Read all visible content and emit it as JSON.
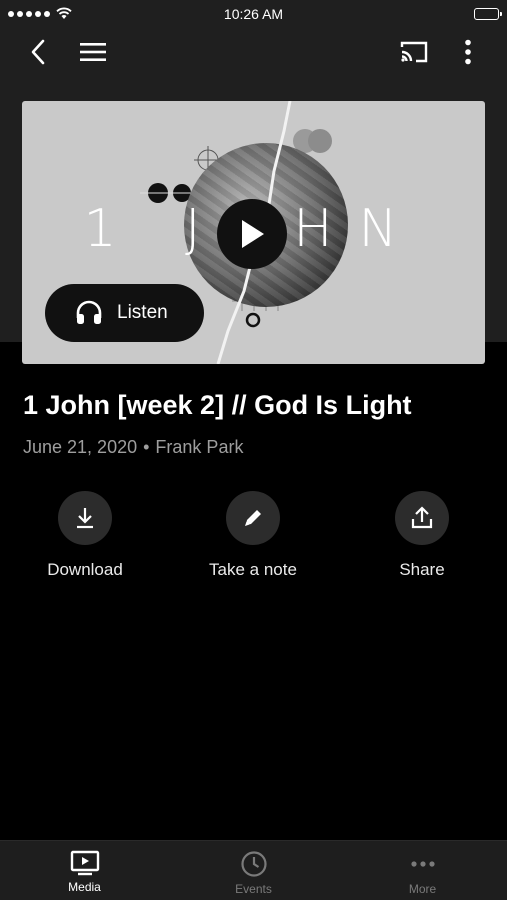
{
  "status_bar": {
    "time": "10:26 AM"
  },
  "nav": {
    "back_icon": "chevron-left-icon",
    "menu_icon": "hamburger-menu-icon",
    "cast_icon": "cast-icon",
    "more_icon": "vertical-ellipsis-icon"
  },
  "media": {
    "artwork_text": "1 JOHN",
    "play_icon": "play-icon",
    "listen_label": "Listen",
    "title": "1 John [week 2] // God Is Light",
    "date": "June 21, 2020",
    "separator": "•",
    "speaker": "Frank Park"
  },
  "actions": [
    {
      "label": "Download",
      "icon": "download-icon"
    },
    {
      "label": "Take a note",
      "icon": "pencil-icon"
    },
    {
      "label": "Share",
      "icon": "share-icon"
    }
  ],
  "tabs": [
    {
      "label": "Media",
      "icon": "tv-play-icon",
      "active": true
    },
    {
      "label": "Events",
      "icon": "clock-icon",
      "active": false
    },
    {
      "label": "More",
      "icon": "horizontal-ellipsis-icon",
      "active": false
    }
  ],
  "colors": {
    "background": "#000000",
    "header": "#1f1f1f",
    "tab_active": "#ffffff",
    "tab_inactive": "#7a7a7a"
  }
}
